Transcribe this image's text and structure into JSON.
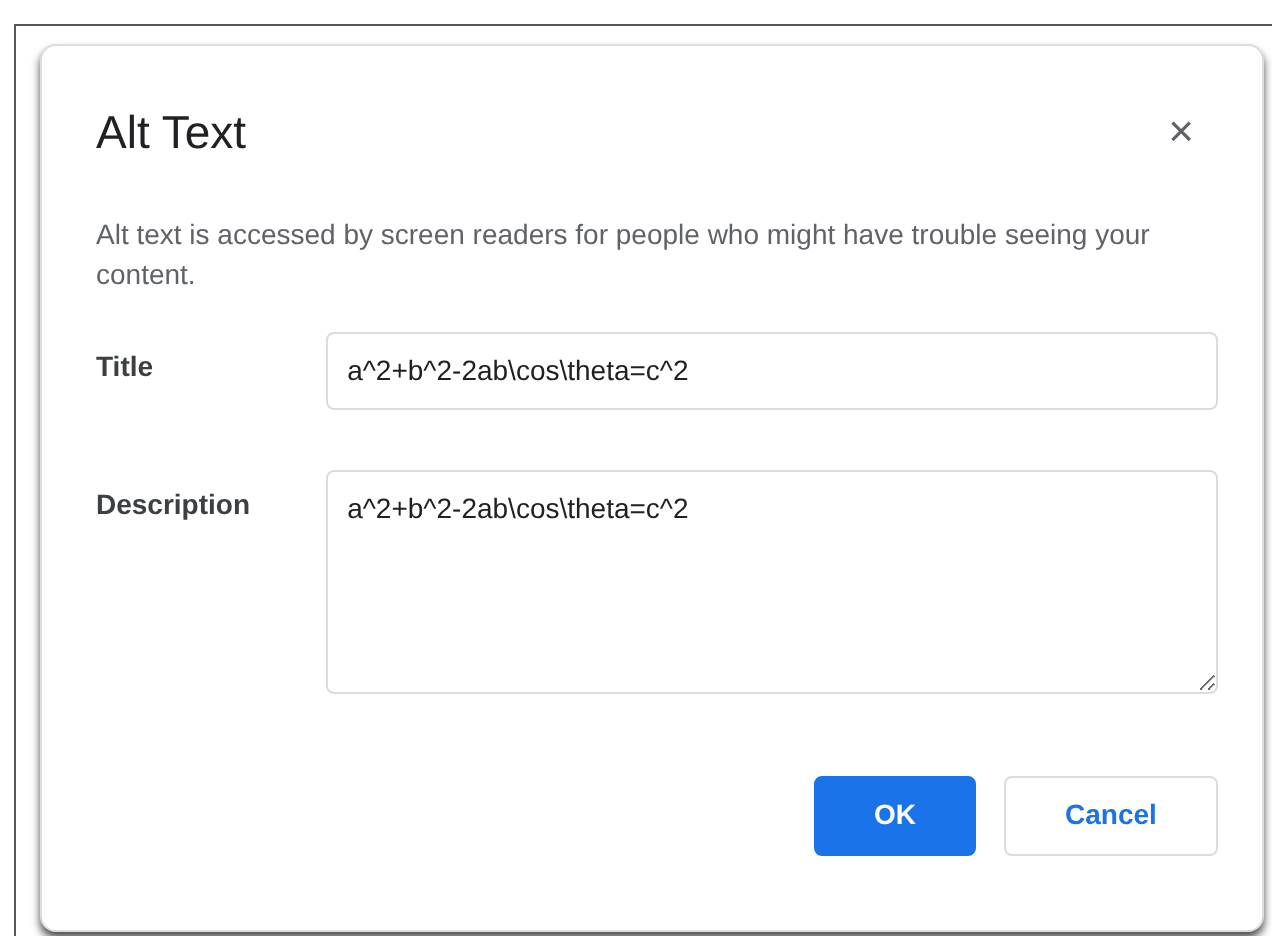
{
  "dialog": {
    "title": "Alt Text",
    "close": "×",
    "intro": "Alt text is accessed by screen readers for people who might have trouble seeing your content."
  },
  "fields": [
    {
      "kind": "input",
      "label": "Title",
      "value": "a^2+b^2-2ab\\cos\\theta=c^2"
    },
    {
      "kind": "textarea",
      "label": "Description",
      "value": "a^2+b^2-2ab\\cos\\theta=c^2"
    }
  ],
  "buttons": [
    {
      "kind": "primary",
      "label": "OK"
    },
    {
      "kind": "secondary",
      "label": "Cancel"
    }
  ]
}
